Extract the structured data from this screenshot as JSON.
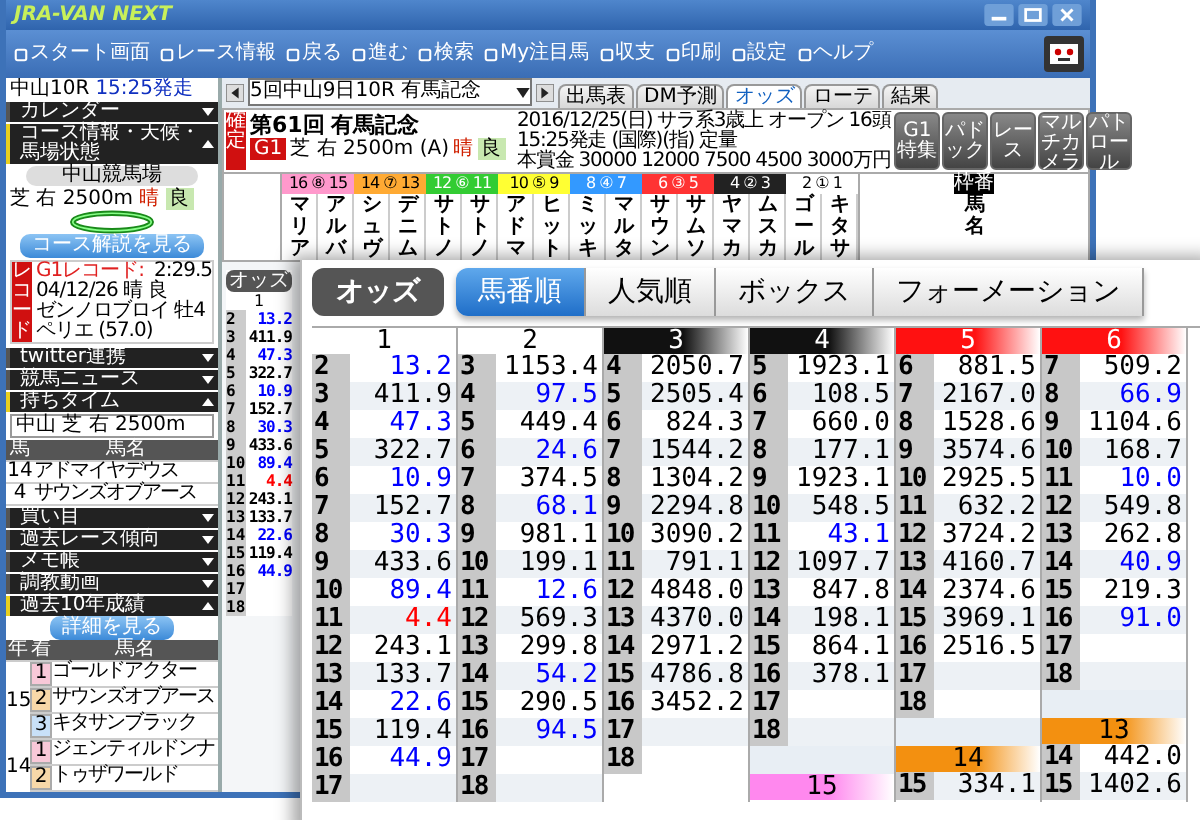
{
  "app": {
    "logo": "JRA-VAN NEXT",
    "toolbar": [
      {
        "label": "スタート画面"
      },
      {
        "label": "レース情報"
      },
      {
        "label": "戻る"
      },
      {
        "label": "進む"
      },
      {
        "label": "検索"
      },
      {
        "label": "My注目馬"
      },
      {
        "label": "収支"
      },
      {
        "label": "印刷"
      },
      {
        "label": "設定"
      },
      {
        "label": "ヘルプ"
      }
    ]
  },
  "sidebar": {
    "race": "中山10R",
    "post_time": "15:25発走",
    "panels_top": [
      {
        "label": "カレンダー",
        "expanded": false
      },
      {
        "label": "コース情報・天候・馬場状態",
        "expanded": true
      }
    ],
    "course": {
      "venue": "中山競馬場",
      "surface": "芝 右 2500m",
      "weather": "晴",
      "going": "良",
      "button": "コース解説を見る"
    },
    "record": {
      "tag": "レコード",
      "label": "G1レコード:",
      "time": "2:29.5",
      "date": "04/12/26 晴 良",
      "horse": "ゼンノロブロイ 牡4",
      "jockey": "ペリエ (57.0)"
    },
    "panels_mid": [
      {
        "label": "twitter連携",
        "expanded": false
      },
      {
        "label": "競馬ニュース",
        "expanded": false
      },
      {
        "label": "持ちタイム",
        "expanded": true
      }
    ],
    "time_table": {
      "filter": "中山 芝 右 2500m",
      "columns": [
        "馬",
        "馬名"
      ],
      "rows": [
        {
          "num": "14",
          "horse": "アドマイヤデウス"
        },
        {
          "num": "4",
          "horse": "サウンズオブアース"
        }
      ]
    },
    "panels_low": [
      {
        "label": "買い目",
        "expanded": false
      },
      {
        "label": "過去レース傾向",
        "expanded": false
      },
      {
        "label": "メモ帳",
        "expanded": false
      },
      {
        "label": "調教動画",
        "expanded": false
      },
      {
        "label": "過去10年成績",
        "expanded": true
      }
    ],
    "detail_button": "詳細を見る",
    "history": {
      "columns": [
        "年",
        "着",
        "馬名"
      ],
      "groups": [
        {
          "year": "15",
          "rows": [
            {
              "place": "1",
              "horse": "ゴールドアクター",
              "color": "#f8c8d8"
            },
            {
              "place": "2",
              "horse": "サウンズオブアース",
              "color": "#f8d8a8"
            },
            {
              "place": "3",
              "horse": "キタサンブラック",
              "color": "#c8e0f8"
            }
          ]
        },
        {
          "year": "14",
          "rows": [
            {
              "place": "1",
              "horse": "ジェンティルドンナ",
              "color": "#f8c8d8"
            },
            {
              "place": "2",
              "horse": "トゥザワールド",
              "color": "#f8d8a8"
            }
          ]
        }
      ]
    }
  },
  "main": {
    "race_select": "5回中山9日10R 有馬記念",
    "tabs": [
      {
        "label": "出馬表",
        "selected": false
      },
      {
        "label": "DM予測",
        "selected": false
      },
      {
        "label": "オッズ",
        "selected": true
      },
      {
        "label": "ローテ",
        "selected": false
      },
      {
        "label": "結果",
        "selected": false
      }
    ],
    "race": {
      "status": "確定",
      "edition": "第61回",
      "name": "有馬記念",
      "grade": "G1",
      "course": "芝 右 2500m (A)",
      "weather": "晴",
      "going": "良",
      "info": [
        "2016/12/25(日) サラ系3歳上 オープン 16頭",
        "15:25発走 (国際)(指) 定量",
        "本賞金 30000 12000 7500 4500 3000万円"
      ],
      "buttons": [
        "G1特集",
        "パドック",
        "レース",
        "マルチカメラ",
        "パトロール"
      ]
    },
    "frames": [
      {
        "label": "16 ⑧ 15",
        "color": "#ff99cc"
      },
      {
        "label": "14 ⑦ 13",
        "color": "#ffaa33"
      },
      {
        "label": "12 ⑥ 11",
        "color": "#33cc33"
      },
      {
        "label": "10 ⑤ 9",
        "color": "#ffff33"
      },
      {
        "label": "8 ④ 7",
        "color": "#3399ff"
      },
      {
        "label": "6 ③ 5",
        "color": "#ff3333"
      },
      {
        "label": "4 ② 3",
        "color": "#222222"
      },
      {
        "label": "2 ① 1",
        "color": "#ffffff"
      }
    ],
    "frame_head": "枠番",
    "name_head": "馬名",
    "horses": [
      "マリア",
      "アルバ",
      "シュヴ",
      "デニム",
      "サトノ",
      "サトノ",
      "アドマ",
      "ヒット",
      "ミッキ",
      "マルタ",
      "サウン",
      "サムソ",
      "ヤマカ",
      "ムスカ",
      "ゴール",
      "キタサ"
    ],
    "odds": {
      "title": "オッズ",
      "header": "1",
      "rows": [
        {
          "num": "2",
          "value": "13.2",
          "color": "#0000ff"
        },
        {
          "num": "3",
          "value": "411.9"
        },
        {
          "num": "4",
          "value": "47.3",
          "color": "#0000ff"
        },
        {
          "num": "5",
          "value": "322.7"
        },
        {
          "num": "6",
          "value": "10.9",
          "color": "#0000ff"
        },
        {
          "num": "7",
          "value": "152.7"
        },
        {
          "num": "8",
          "value": "30.3",
          "color": "#0000ff"
        },
        {
          "num": "9",
          "value": "433.6"
        },
        {
          "num": "10",
          "value": "89.4",
          "color": "#0000ff"
        },
        {
          "num": "11",
          "value": "4.4",
          "color": "#ff0000"
        },
        {
          "num": "12",
          "value": "243.1"
        },
        {
          "num": "13",
          "value": "133.7"
        },
        {
          "num": "14",
          "value": "22.6",
          "color": "#0000ff"
        },
        {
          "num": "15",
          "value": "119.4"
        },
        {
          "num": "16",
          "value": "44.9",
          "color": "#0000ff"
        },
        {
          "num": "17"
        },
        {
          "num": "18"
        }
      ]
    }
  },
  "odds_panel": {
    "title": "オッズ",
    "tabs": [
      {
        "label": "馬番順",
        "selected": true
      },
      {
        "label": "人気順",
        "selected": false
      },
      {
        "label": "ボックス",
        "selected": false
      },
      {
        "label": "フォーメーション",
        "selected": false
      }
    ],
    "columns": [
      {
        "blocks": [
          {
            "header": "1",
            "color": "#ffffff",
            "rows": [
              {
                "num": "2",
                "value": "13.2",
                "color": "#0000ff"
              },
              {
                "num": "3",
                "value": "411.9"
              },
              {
                "num": "4",
                "value": "47.3",
                "color": "#0000ff"
              },
              {
                "num": "5",
                "value": "322.7"
              },
              {
                "num": "6",
                "value": "10.9",
                "color": "#0000ff"
              },
              {
                "num": "7",
                "value": "152.7"
              },
              {
                "num": "8",
                "value": "30.3",
                "color": "#0000ff"
              },
              {
                "num": "9",
                "value": "433.6"
              },
              {
                "num": "10",
                "value": "89.4",
                "color": "#0000ff"
              },
              {
                "num": "11",
                "value": "4.4",
                "color": "#ff0000"
              },
              {
                "num": "12",
                "value": "243.1"
              },
              {
                "num": "13",
                "value": "133.7"
              },
              {
                "num": "14",
                "value": "22.6",
                "color": "#0000ff"
              },
              {
                "num": "15",
                "value": "119.4"
              },
              {
                "num": "16",
                "value": "44.9",
                "color": "#0000ff"
              },
              {
                "num": "17"
              }
            ]
          }
        ]
      },
      {
        "blocks": [
          {
            "header": "2",
            "color": "#ffffff",
            "rows": [
              {
                "num": "3",
                "value": "1153.4"
              },
              {
                "num": "4",
                "value": "97.5",
                "color": "#0000ff"
              },
              {
                "num": "5",
                "value": "449.4"
              },
              {
                "num": "6",
                "value": "24.6",
                "color": "#0000ff"
              },
              {
                "num": "7",
                "value": "374.5"
              },
              {
                "num": "8",
                "value": "68.1",
                "color": "#0000ff"
              },
              {
                "num": "9",
                "value": "981.1"
              },
              {
                "num": "10",
                "value": "199.1"
              },
              {
                "num": "11",
                "value": "12.6",
                "color": "#0000ff"
              },
              {
                "num": "12",
                "value": "569.3"
              },
              {
                "num": "13",
                "value": "299.8"
              },
              {
                "num": "14",
                "value": "54.2",
                "color": "#0000ff"
              },
              {
                "num": "15",
                "value": "290.5"
              },
              {
                "num": "16",
                "value": "94.5",
                "color": "#0000ff"
              },
              {
                "num": "17"
              },
              {
                "num": "18"
              }
            ]
          }
        ]
      },
      {
        "blocks": [
          {
            "header": "3",
            "color": "#111111",
            "rows": [
              {
                "num": "4",
                "value": "2050.7"
              },
              {
                "num": "5",
                "value": "2505.4"
              },
              {
                "num": "6",
                "value": "824.3"
              },
              {
                "num": "7",
                "value": "1544.2"
              },
              {
                "num": "8",
                "value": "1304.2"
              },
              {
                "num": "9",
                "value": "2294.8"
              },
              {
                "num": "10",
                "value": "3090.2"
              },
              {
                "num": "11",
                "value": "791.1"
              },
              {
                "num": "12",
                "value": "4848.0"
              },
              {
                "num": "13",
                "value": "4370.0"
              },
              {
                "num": "14",
                "value": "2971.2"
              },
              {
                "num": "15",
                "value": "4786.8"
              },
              {
                "num": "16",
                "value": "3452.2"
              },
              {
                "num": "17"
              },
              {
                "num": "18"
              }
            ]
          }
        ]
      },
      {
        "blocks": [
          {
            "header": "4",
            "color": "#111111",
            "rows": [
              {
                "num": "5",
                "value": "1923.1"
              },
              {
                "num": "6",
                "value": "108.5"
              },
              {
                "num": "7",
                "value": "660.0"
              },
              {
                "num": "8",
                "value": "177.1"
              },
              {
                "num": "9",
                "value": "1923.1"
              },
              {
                "num": "10",
                "value": "548.5"
              },
              {
                "num": "11",
                "value": "43.1",
                "color": "#0000ff"
              },
              {
                "num": "12",
                "value": "1097.7"
              },
              {
                "num": "13",
                "value": "847.8"
              },
              {
                "num": "14",
                "value": "198.1"
              },
              {
                "num": "15",
                "value": "864.1"
              },
              {
                "num": "16",
                "value": "378.1"
              },
              {
                "num": "17"
              },
              {
                "num": "18"
              }
            ]
          },
          {
            "header": "15",
            "color": "#ff88ee"
          }
        ]
      },
      {
        "blocks": [
          {
            "header": "5",
            "color": "#ff1111",
            "rows": [
              {
                "num": "6",
                "value": "881.5"
              },
              {
                "num": "7",
                "value": "2167.0"
              },
              {
                "num": "8",
                "value": "1528.6"
              },
              {
                "num": "9",
                "value": "3574.6"
              },
              {
                "num": "10",
                "value": "2925.5"
              },
              {
                "num": "11",
                "value": "632.2"
              },
              {
                "num": "12",
                "value": "3724.2"
              },
              {
                "num": "13",
                "value": "4160.7"
              },
              {
                "num": "14",
                "value": "2374.6"
              },
              {
                "num": "15",
                "value": "3969.1"
              },
              {
                "num": "16",
                "value": "2516.5"
              },
              {
                "num": "17"
              },
              {
                "num": "18"
              }
            ]
          },
          {
            "header": "14",
            "color": "#f39010",
            "rows": [
              {
                "num": "15",
                "value": "334.1"
              }
            ]
          }
        ]
      },
      {
        "blocks": [
          {
            "header": "6",
            "color": "#ff1111",
            "rows": [
              {
                "num": "7",
                "value": "509.2"
              },
              {
                "num": "8",
                "value": "66.9",
                "color": "#0000ff"
              },
              {
                "num": "9",
                "value": "1104.6"
              },
              {
                "num": "10",
                "value": "168.7"
              },
              {
                "num": "11",
                "value": "10.0",
                "color": "#0000ff"
              },
              {
                "num": "12",
                "value": "549.8"
              },
              {
                "num": "13",
                "value": "262.8"
              },
              {
                "num": "14",
                "value": "40.9",
                "color": "#0000ff"
              },
              {
                "num": "15",
                "value": "219.3"
              },
              {
                "num": "16",
                "value": "91.0",
                "color": "#0000ff"
              },
              {
                "num": "17"
              },
              {
                "num": "18"
              }
            ]
          },
          {
            "header": "13",
            "color": "#f39010",
            "rows": [
              {
                "num": "14",
                "value": "442.0"
              },
              {
                "num": "15",
                "value": "1402.6"
              }
            ]
          }
        ]
      }
    ]
  }
}
